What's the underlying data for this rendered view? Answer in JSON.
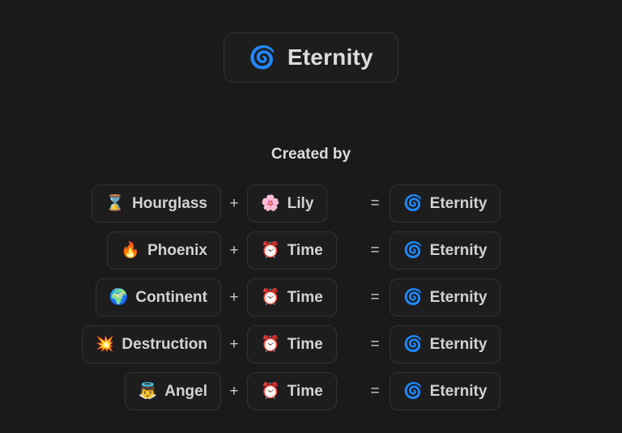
{
  "title": {
    "emoji": "🌀",
    "icon_name": "cyclone-icon",
    "label": "Eternity"
  },
  "section": {
    "heading": "Created by"
  },
  "operators": {
    "plus": "+",
    "equals": "="
  },
  "colors": {
    "page_background": "#1a1a1a",
    "chip_background": "#1d1d1d",
    "chip_border": "#333333",
    "text": "#d6d6d6"
  },
  "recipes": [
    {
      "a": {
        "emoji": "⌛",
        "label": "Hourglass"
      },
      "b": {
        "emoji": "🌸",
        "label": "Lily"
      },
      "result": {
        "emoji": "🌀",
        "label": "Eternity"
      }
    },
    {
      "a": {
        "emoji": "🔥",
        "label": "Phoenix"
      },
      "b": {
        "emoji": "⏰",
        "label": "Time"
      },
      "result": {
        "emoji": "🌀",
        "label": "Eternity"
      }
    },
    {
      "a": {
        "emoji": "🌍",
        "label": "Continent"
      },
      "b": {
        "emoji": "⏰",
        "label": "Time"
      },
      "result": {
        "emoji": "🌀",
        "label": "Eternity"
      }
    },
    {
      "a": {
        "emoji": "💥",
        "label": "Destruction"
      },
      "b": {
        "emoji": "⏰",
        "label": "Time"
      },
      "result": {
        "emoji": "🌀",
        "label": "Eternity"
      }
    },
    {
      "a": {
        "emoji": "👼",
        "label": "Angel"
      },
      "b": {
        "emoji": "⏰",
        "label": "Time"
      },
      "result": {
        "emoji": "🌀",
        "label": "Eternity"
      }
    }
  ]
}
